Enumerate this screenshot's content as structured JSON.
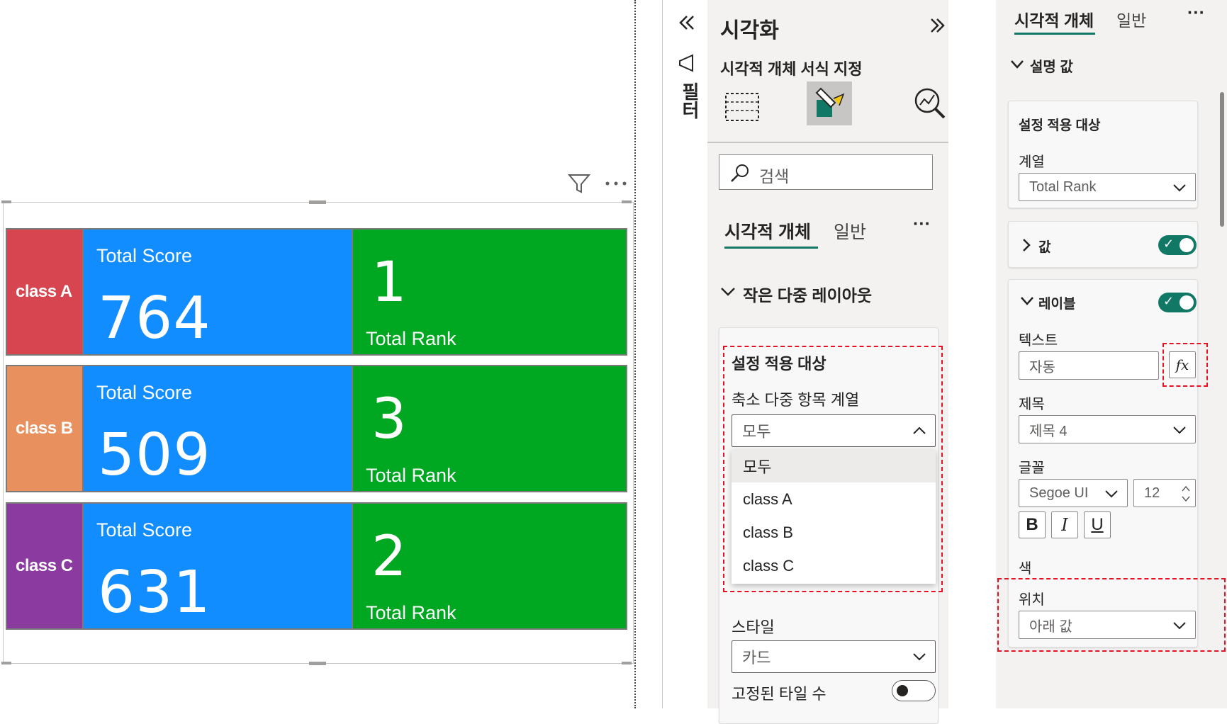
{
  "canvas": {
    "rows": [
      {
        "label": "class A",
        "color": "#d64550",
        "score_title": "Total Score",
        "score": "764",
        "rank": "1",
        "rank_label": "Total Rank"
      },
      {
        "label": "class B",
        "color": "#e8915f",
        "score_title": "Total Score",
        "score": "509",
        "rank": "3",
        "rank_label": "Total Rank"
      },
      {
        "label": "class C",
        "color": "#8b3b9f",
        "score_title": "Total Score",
        "score": "631",
        "rank": "2",
        "rank_label": "Total Rank"
      }
    ],
    "score_color": "#118dff",
    "rank_color": "#00a821"
  },
  "filter_strip": {
    "label": "필터"
  },
  "viz_pane": {
    "title": "시각화",
    "subtitle": "시각적 개체 서식 지정",
    "search_placeholder": "검색",
    "tabs": [
      "시각적 개체",
      "일반"
    ],
    "more": "···",
    "section": "작은 다중 레이아웃",
    "apply_to": "설정 적용 대상",
    "series_label": "축소 다중 항목 계열",
    "series_value": "모두",
    "dropdown_options": [
      "모두",
      "class A",
      "class B",
      "class C"
    ],
    "style_label": "스타일",
    "style_value": "카드",
    "fixed_tiles_label": "고정된 타일 수"
  },
  "format_pane": {
    "tabs": [
      "시각적 개체",
      "일반"
    ],
    "more": "···",
    "callout_section": "설명 값",
    "apply_to": "설정 적용 대상",
    "series_label": "계열",
    "series_value": "Total Rank",
    "values_section": "값",
    "labels_section": "레이블",
    "text_label": "텍스트",
    "text_value": "자동",
    "fx_label": "fx",
    "heading_label": "제목",
    "heading_value": "제목 4",
    "font_label": "글꼴",
    "font_value": "Segoe UI",
    "font_size": "12",
    "bold": "B",
    "italic": "I",
    "underline": "U",
    "color_label": "색",
    "position_label": "위치",
    "position_value": "아래 값"
  },
  "icons": [
    "filter-icon",
    "more-icon",
    "collapse-left-icon",
    "expand-right-icon",
    "megaphone-icon",
    "build-visual-icon",
    "format-visual-icon",
    "analytics-icon",
    "search-icon",
    "chevron-down-icon"
  ],
  "accent_color": "#117865"
}
